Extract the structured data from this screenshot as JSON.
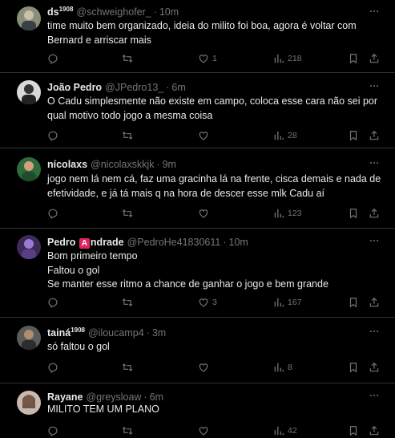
{
  "posts": [
    {
      "name": "ds",
      "name_sup": "1908",
      "handle": "@schweighofer_",
      "time": "10m",
      "lines": [
        "time muito bem organizado, ideia do milito foi boa, agora é voltar com",
        "Bernard e arriscar mais"
      ],
      "likes": "1",
      "views": "218"
    },
    {
      "name": "João Pedro",
      "handle": "@JPedro13_",
      "time": "6m",
      "lines": [
        "O Cadu simplesmente não existe em campo, coloca esse cara não sei por",
        "qual motivo todo jogo a mesma coisa"
      ],
      "likes": "",
      "views": "28"
    },
    {
      "name": "nícolaxs",
      "handle": "@nicolaxskkjk",
      "time": "9m",
      "lines": [
        "jogo nem lá nem cá, faz uma gracinha lá na frente, cisca demais e nada de",
        "efetividade, e já tá mais q na hora de descer esse mlk Cadu aí"
      ],
      "likes": "",
      "views": "123"
    },
    {
      "name_before": "Pedro",
      "name_flag": "A",
      "name_after": "ndrade",
      "handle": "@PedroHe41830611",
      "time": "10m",
      "lines": [
        "Bom primeiro tempo",
        "Faltou o gol",
        "Se manter esse ritmo a chance de ganhar o jogo e bem grande"
      ],
      "likes": "3",
      "views": "167"
    },
    {
      "name": "tainá",
      "name_sup": "1908",
      "handle": "@iloucamp4",
      "time": "3m",
      "lines": [
        "só faltou o gol"
      ],
      "likes": "",
      "views": "8"
    },
    {
      "name": "Rayane",
      "handle": "@greysloaw",
      "time": "6m",
      "lines": [
        "MILITO TEM UM PLANO"
      ],
      "likes": "",
      "views": "42"
    }
  ],
  "colors": {
    "background": "#000000",
    "text": "#e7e9ea",
    "muted": "#71767b",
    "divider": "#2f3336"
  },
  "icons": [
    "reply-icon",
    "retweet-icon",
    "like-icon",
    "views-icon",
    "bookmark-icon",
    "share-icon",
    "more-icon"
  ]
}
